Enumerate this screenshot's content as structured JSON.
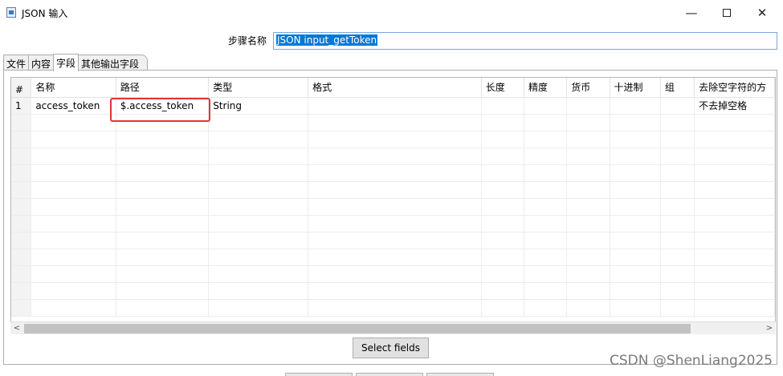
{
  "window": {
    "title": "JSON 输入",
    "minimize_glyph": "—",
    "close_glyph": "✕"
  },
  "step": {
    "label": "步骤名称",
    "value": "JSON input_getToken"
  },
  "tabs": [
    {
      "label": "文件",
      "active": false
    },
    {
      "label": "内容",
      "active": false
    },
    {
      "label": "字段",
      "active": true
    },
    {
      "label": "其他输出字段",
      "active": false
    }
  ],
  "fields_table": {
    "sort_glyph": "^",
    "columns": [
      "#",
      "名称",
      "路径",
      "类型",
      "格式",
      "长度",
      "精度",
      "货币",
      "十进制",
      "组",
      "去除空字符的方"
    ],
    "rows": [
      [
        "1",
        "access_token",
        "$.access_token",
        "String",
        "",
        "",
        "",
        "",
        "",
        "",
        "不去掉空格"
      ]
    ],
    "empty_rows": 12
  },
  "scrollbar": {
    "left_glyph": "<",
    "right_glyph": ">"
  },
  "buttons": {
    "select_fields": "Select fields"
  },
  "watermark": "CSDN @ShenLiang2025",
  "colors": {
    "accent": "#0078d7",
    "highlight": "#e53333"
  }
}
